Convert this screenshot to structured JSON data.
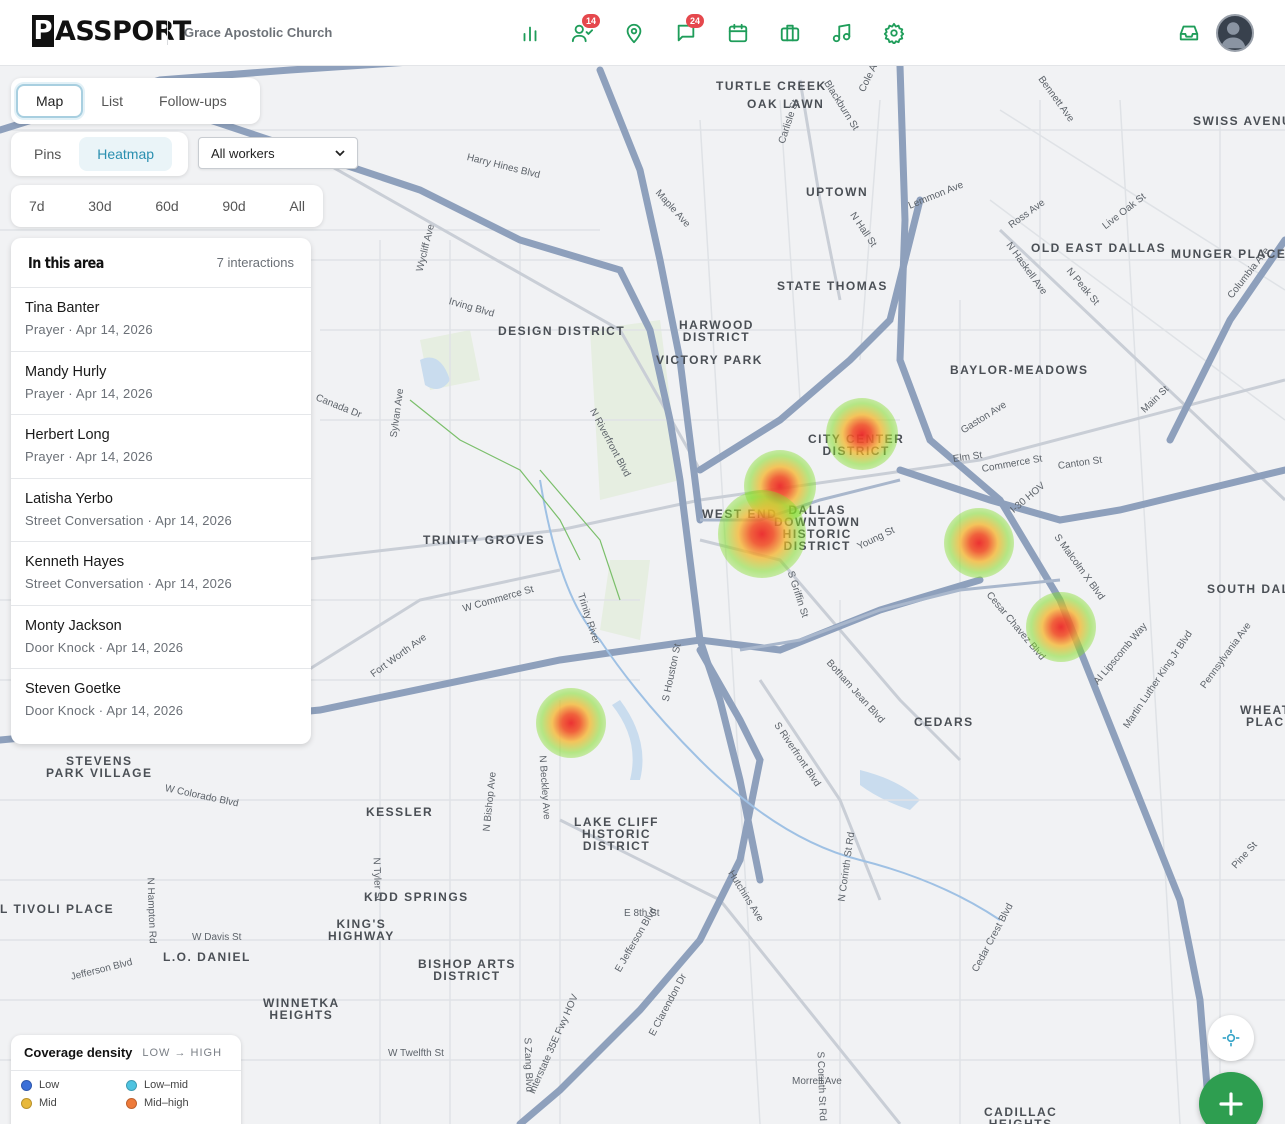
{
  "app": {
    "logo_letter": "P",
    "logo_rest": "ASSPORT",
    "org_name": "Grace Apostolic Church"
  },
  "nav": {
    "items": [
      {
        "icon": "bar-chart-icon"
      },
      {
        "icon": "people-icon",
        "badge": "14"
      },
      {
        "icon": "map-pin-icon"
      },
      {
        "icon": "message-square-icon",
        "badge": "24"
      },
      {
        "icon": "calendar-icon"
      },
      {
        "icon": "briefcase-icon"
      },
      {
        "icon": "music-icon"
      },
      {
        "icon": "gear-icon"
      }
    ],
    "inbox_icon": "inbox-icon",
    "avatar_icon": "user-avatar-icon"
  },
  "view_tabs": {
    "map": "Map",
    "list": "List",
    "followups": "Follow-ups",
    "active": "Map"
  },
  "layer_tabs": {
    "pins": "Pins",
    "heatmap": "Heatmap",
    "active": "Heatmap"
  },
  "worker_filter": {
    "value": "All workers"
  },
  "range_tabs": [
    "7d",
    "30d",
    "60d",
    "90d",
    "All"
  ],
  "area_panel": {
    "title": "In this area",
    "count": "7 interactions",
    "items": [
      {
        "name": "Tina Banter",
        "meta": "Prayer · Apr 14, 2026"
      },
      {
        "name": "Mandy Hurly",
        "meta": "Prayer · Apr 14, 2026"
      },
      {
        "name": "Herbert Long",
        "meta": "Prayer · Apr 14, 2026"
      },
      {
        "name": "Latisha Yerbo",
        "meta": "Street Conversation · Apr 14, 2026"
      },
      {
        "name": "Kenneth Hayes",
        "meta": "Street Conversation · Apr 14, 2026"
      },
      {
        "name": "Monty Jackson",
        "meta": "Door Knock · Apr 14, 2026"
      },
      {
        "name": "Steven Goetke",
        "meta": "Door Knock · Apr 14, 2026"
      }
    ]
  },
  "legend": {
    "title": "Coverage density",
    "scale": "LOW → HIGH",
    "items": [
      {
        "label": "Low",
        "color": "#3b6fd8"
      },
      {
        "label": "Low–mid",
        "color": "#4ec3e0"
      },
      {
        "label": "Mid",
        "color": "#e8b83a"
      },
      {
        "label": "Mid–high",
        "color": "#ee7a3a"
      }
    ]
  },
  "map": {
    "neighborhoods": [
      "TURTLE CREEK",
      "OAK LAWN",
      "UPTOWN",
      "STATE THOMAS",
      "SWISS AVENU",
      "OLD EAST DALLAS",
      "MUNGER PLACE",
      "HARWOOD\nDISTRICT",
      "VICTORY PARK",
      "DESIGN DISTRICT",
      "BAYLOR-MEADOWS",
      "CITY CENTER\nDISTRICT",
      "WEST END",
      "DALLAS\nDOWNTOWN\nHISTORIC\nDISTRICT",
      "TRINITY GROVES",
      "SOUTH DALL",
      "STEVENS\nPARK VILLAGE",
      "KESSLER",
      "LAKE CLIFF\nHISTORIC\nDISTRICT",
      "CEDARS",
      "WHEAT\nPLAC",
      "KIDD SPRINGS",
      "L TIVOLI PLACE",
      "KING'S\nHIGHWAY",
      "L.O. DANIEL",
      "BISHOP ARTS\nDISTRICT",
      "WINNETKA\nHEIGHTS",
      "CADILLAC\nHEIGHTS"
    ],
    "streets": [
      "Harry Hines Blvd",
      "Irving Blvd",
      "Maple Ave",
      "Lemmon Ave",
      "N Hall St",
      "Ross Ave",
      "Gaston Ave",
      "Elm St",
      "Commerce St",
      "Canton St",
      "Main St",
      "Young St",
      "S Griffin St",
      "N Riverfront Blvd",
      "W Commerce St",
      "Fort Worth Ave",
      "Sylvan Ave",
      "Wycliff Ave",
      "Canada Dr",
      "Trinity River",
      "W Colorado Blvd",
      "N Beckley Ave",
      "W Davis St",
      "Jefferson Blvd",
      "N Bishop Ave",
      "E 8th St",
      "Hutchins Ave",
      "S Riverfront Blvd",
      "Botham Jean Blvd",
      "Cesar Chavez Blvd",
      "S Malcolm X Blvd",
      "Al Lipscomb Way",
      "Martin Luther King Jr Blvd",
      "Pennsylvania Ave",
      "Interstate 35E Fwy HOV",
      "Cedar Crest Blvd",
      "S Corinth St Rd",
      "W Twelfth St",
      "Morrell Ave",
      "S Zang Blvd",
      "N Tyler St",
      "N Hampton Rd",
      "Carlisle St",
      "Cole Ave",
      "Blackburn St",
      "N Peak St",
      "Live Oak St",
      "N Haskell Ave",
      "Bennett Ave",
      "Columbia Ave",
      "E Jefferson Blvd",
      "E Clarendon Dr",
      "S Houston St",
      "N Corinth St Rd",
      "Pine St",
      "I-30 HOV"
    ]
  }
}
